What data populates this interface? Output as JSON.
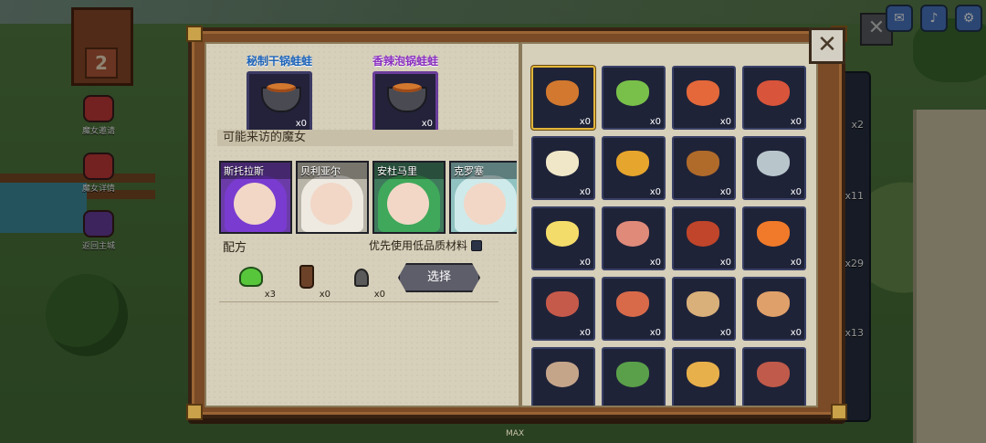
{
  "hud": {
    "house_level": "2",
    "side_buttons": [
      "魔女邀请",
      "魔女详情",
      "返回主城"
    ],
    "right_strip_counts": [
      "x2",
      "x11",
      "x29",
      "x13"
    ],
    "bottom_label": "MAX"
  },
  "book": {
    "close_icon": "✕",
    "featured_dishes": [
      {
        "name": "秘制干锅蛙蛙",
        "count": "x0"
      },
      {
        "name": "香辣泡锅蛙蛙",
        "count": "x0"
      }
    ],
    "visiting_witches_title": "可能来访的魔女",
    "witches": [
      "斯托拉斯",
      "贝利亚尔",
      "安杜马里",
      "克罗塞"
    ],
    "recipe_label": "配方",
    "prefer_low_quality_label": "优先使用低品质材料",
    "ingredients": [
      {
        "icon": "frog-icon",
        "count": "x3"
      },
      {
        "icon": "bottle-icon",
        "count": "x0"
      },
      {
        "icon": "flask-icon",
        "count": "x0"
      }
    ],
    "select_button": "选择",
    "recipe_grid": [
      {
        "icon": "frog-pot-dish",
        "count": "x0",
        "color": "#d2782f"
      },
      {
        "icon": "salad-dish",
        "count": "x0",
        "color": "#79c04a"
      },
      {
        "icon": "shrimp-dish",
        "count": "x0",
        "color": "#e4683a"
      },
      {
        "icon": "soup-bowl-dish",
        "count": "x0",
        "color": "#d8543a"
      },
      {
        "icon": "rice-bowl-dish",
        "count": "x0",
        "color": "#efe7c8"
      },
      {
        "icon": "fries-dish",
        "count": "x0",
        "color": "#e6a52c"
      },
      {
        "icon": "burger-dish",
        "count": "x0",
        "color": "#b06a2a"
      },
      {
        "icon": "fish-plate-dish",
        "count": "x0",
        "color": "#b8c6cc"
      },
      {
        "icon": "egg-dish",
        "count": "x0",
        "color": "#f4dc6a"
      },
      {
        "icon": "meat-dish",
        "count": "x0",
        "color": "#e08a7a"
      },
      {
        "icon": "fried-chicken-dish",
        "count": "x0",
        "color": "#c0452a"
      },
      {
        "icon": "flaming-dish",
        "count": "x0",
        "color": "#f07a2a"
      },
      {
        "icon": "bento-dish",
        "count": "x0",
        "color": "#c65a4a"
      },
      {
        "icon": "sandwich-dish",
        "count": "x0",
        "color": "#d86a4a"
      },
      {
        "icon": "pie-dish",
        "count": "x0",
        "color": "#d9b07a"
      },
      {
        "icon": "toast-dish",
        "count": "x0",
        "color": "#e0a06a"
      },
      {
        "icon": "dumpling-dish",
        "count": "",
        "color": "#c5a58a"
      },
      {
        "icon": "veggie-dish",
        "count": "",
        "color": "#5aa04a"
      },
      {
        "icon": "omelette-dish",
        "count": "",
        "color": "#e8b04a"
      },
      {
        "icon": "steak-dish",
        "count": "",
        "color": "#c05a4a"
      }
    ]
  }
}
